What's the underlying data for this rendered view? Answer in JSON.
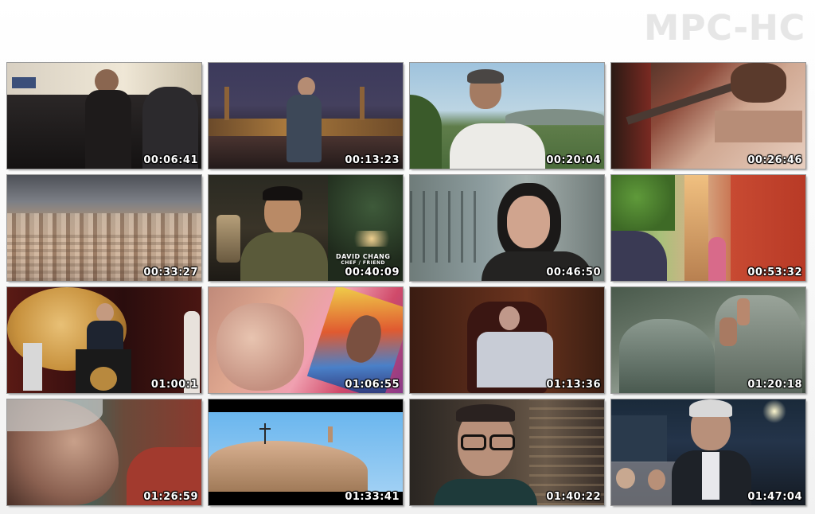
{
  "app": {
    "logo_text": "MPC-HC"
  },
  "thumbnails": [
    {
      "timestamp": "00:06:41"
    },
    {
      "timestamp": "00:13:23"
    },
    {
      "timestamp": "00:20:04"
    },
    {
      "timestamp": "00:26:46"
    },
    {
      "timestamp": "00:33:27"
    },
    {
      "timestamp": "00:40:09",
      "caption_name": "DAVID CHANG",
      "caption_role": "CHEF / FRIEND"
    },
    {
      "timestamp": "00:46:50"
    },
    {
      "timestamp": "00:53:32"
    },
    {
      "timestamp": "01:00:1"
    },
    {
      "timestamp": "01:06:55"
    },
    {
      "timestamp": "01:13:36"
    },
    {
      "timestamp": "01:20:18"
    },
    {
      "timestamp": "01:26:59"
    },
    {
      "timestamp": "01:33:41"
    },
    {
      "timestamp": "01:40:22"
    },
    {
      "timestamp": "01:47:04"
    }
  ]
}
